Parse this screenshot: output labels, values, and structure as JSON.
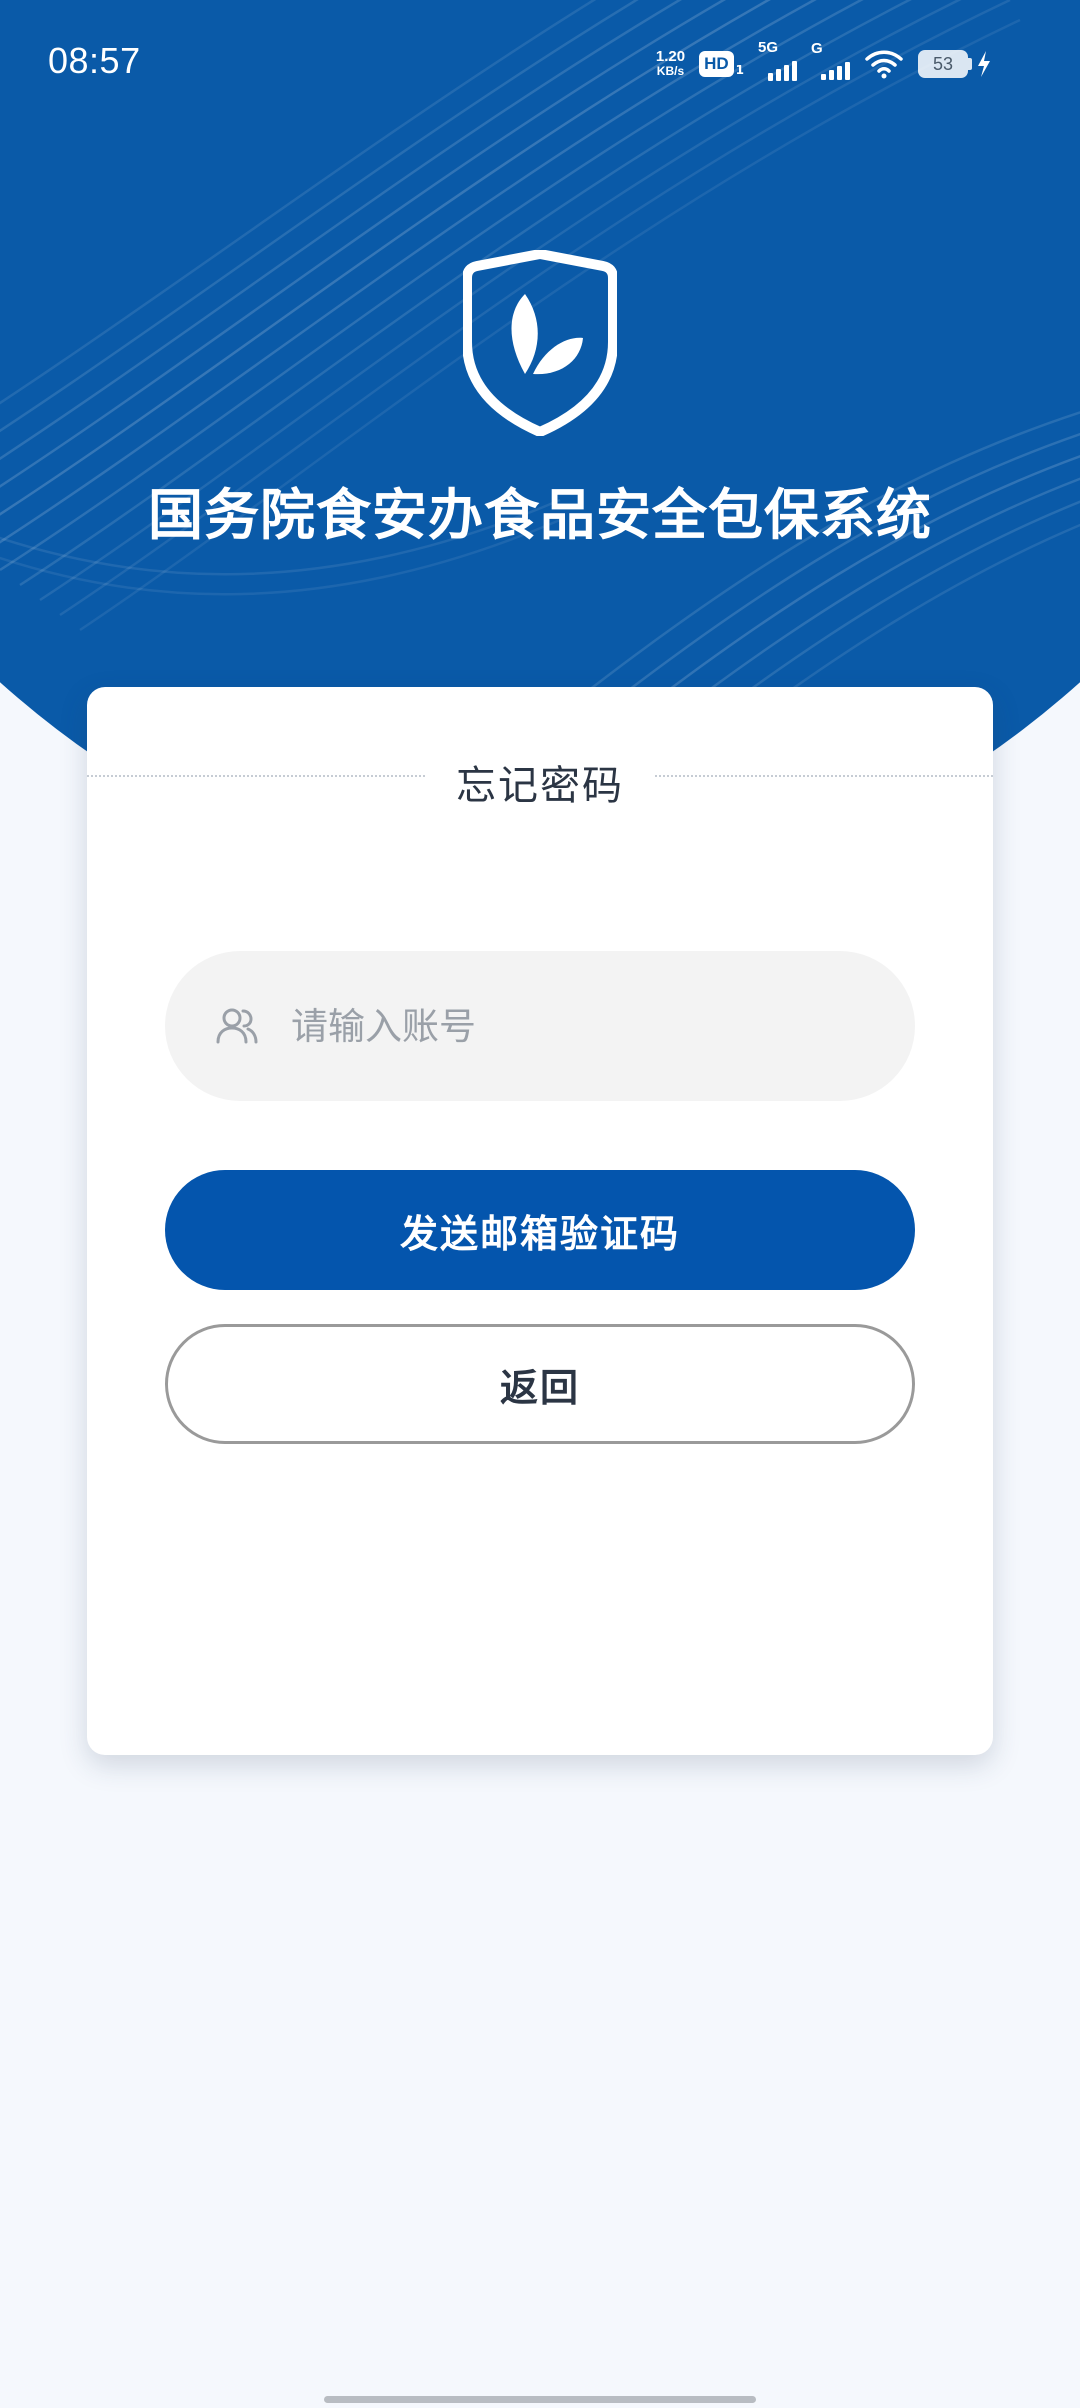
{
  "status_bar": {
    "time": "08:57",
    "net_speed_value": "1.20",
    "net_speed_unit": "KB/s",
    "hd_label": "HD",
    "hd_sub": "1",
    "signal_1_label": "5G",
    "signal_2_label": "G",
    "battery_level": "53"
  },
  "app": {
    "title": "国务院食安办食品安全包保系统",
    "brand_color": "#0a5aa8"
  },
  "card": {
    "title": "忘记密码",
    "account_placeholder": "请输入账号",
    "account_value": "",
    "send_button_label": "发送邮箱验证码",
    "back_button_label": "返回"
  },
  "icons": {
    "logo": "shield-leaf-icon",
    "account": "users-icon",
    "wifi": "wifi-icon",
    "charging": "bolt-icon"
  }
}
